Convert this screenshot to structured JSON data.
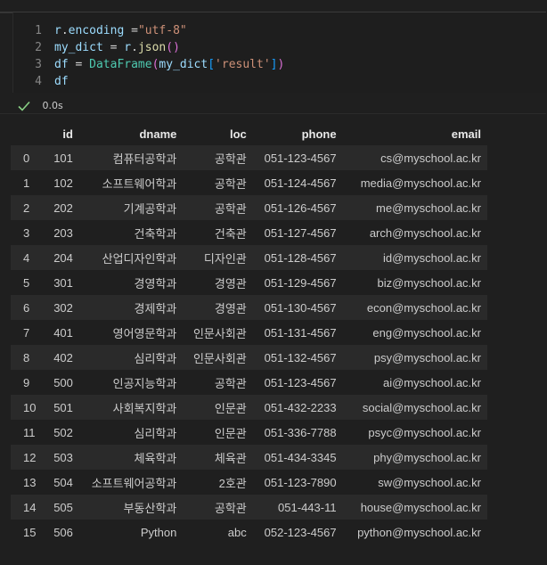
{
  "cell": {
    "lines": [
      {
        "num": "1",
        "tokens": [
          {
            "text": "r",
            "cls": "t-var"
          },
          {
            "text": ".",
            "cls": "t-pun"
          },
          {
            "text": "encoding",
            "cls": "t-var"
          },
          {
            "text": " =",
            "cls": "t-op"
          },
          {
            "text": "\"utf-8\"",
            "cls": "t-str"
          }
        ]
      },
      {
        "num": "2",
        "tokens": [
          {
            "text": "my_dict",
            "cls": "t-var"
          },
          {
            "text": " = ",
            "cls": "t-op"
          },
          {
            "text": "r",
            "cls": "t-var"
          },
          {
            "text": ".",
            "cls": "t-pun"
          },
          {
            "text": "json",
            "cls": "t-fn"
          },
          {
            "text": "()",
            "cls": "t-brk"
          }
        ]
      },
      {
        "num": "3",
        "tokens": [
          {
            "text": "df",
            "cls": "t-var"
          },
          {
            "text": " = ",
            "cls": "t-op"
          },
          {
            "text": "DataFrame",
            "cls": "t-cls"
          },
          {
            "text": "(",
            "cls": "t-brk"
          },
          {
            "text": "my_dict",
            "cls": "t-var"
          },
          {
            "text": "[",
            "cls": "t-brk2"
          },
          {
            "text": "'result'",
            "cls": "t-str"
          },
          {
            "text": "]",
            "cls": "t-brk2"
          },
          {
            "text": ")",
            "cls": "t-brk"
          }
        ]
      },
      {
        "num": "4",
        "tokens": [
          {
            "text": "df",
            "cls": "t-var"
          }
        ]
      }
    ],
    "status": {
      "icon": "check-icon",
      "icon_color": "#89d185",
      "duration": "0.0s"
    }
  },
  "output": {
    "columns": [
      "",
      "id",
      "dname",
      "loc",
      "phone",
      "email"
    ],
    "rows": [
      [
        "0",
        "101",
        "컴퓨터공학과",
        "공학관",
        "051-123-4567",
        "cs@myschool.ac.kr"
      ],
      [
        "1",
        "102",
        "소프트웨어학과",
        "공학관",
        "051-124-4567",
        "media@myschool.ac.kr"
      ],
      [
        "2",
        "202",
        "기계공학과",
        "공학관",
        "051-126-4567",
        "me@myschool.ac.kr"
      ],
      [
        "3",
        "203",
        "건축학과",
        "건축관",
        "051-127-4567",
        "arch@myschool.ac.kr"
      ],
      [
        "4",
        "204",
        "산업디자인학과",
        "디자인관",
        "051-128-4567",
        "id@myschool.ac.kr"
      ],
      [
        "5",
        "301",
        "경영학과",
        "경영관",
        "051-129-4567",
        "biz@myschool.ac.kr"
      ],
      [
        "6",
        "302",
        "경제학과",
        "경영관",
        "051-130-4567",
        "econ@myschool.ac.kr"
      ],
      [
        "7",
        "401",
        "영어영문학과",
        "인문사회관",
        "051-131-4567",
        "eng@myschool.ac.kr"
      ],
      [
        "8",
        "402",
        "심리학과",
        "인문사회관",
        "051-132-4567",
        "psy@myschool.ac.kr"
      ],
      [
        "9",
        "500",
        "인공지능학과",
        "공학관",
        "051-123-4567",
        "ai@myschool.ac.kr"
      ],
      [
        "10",
        "501",
        "사회복지학과",
        "인문관",
        "051-432-2233",
        "social@myschool.ac.kr"
      ],
      [
        "11",
        "502",
        "심리학과",
        "인문관",
        "051-336-7788",
        "psyc@myschool.ac.kr"
      ],
      [
        "12",
        "503",
        "체육학과",
        "체육관",
        "051-434-3345",
        "phy@myschool.ac.kr"
      ],
      [
        "13",
        "504",
        "소프트웨어공학과",
        "2호관",
        "051-123-7890",
        "sw@myschool.ac.kr"
      ],
      [
        "14",
        "505",
        "부동산학과",
        "공학관",
        "051-443-11",
        "house@myschool.ac.kr"
      ],
      [
        "15",
        "506",
        "Python",
        "abc",
        "052-123-4567",
        "python@myschool.ac.kr"
      ]
    ]
  }
}
